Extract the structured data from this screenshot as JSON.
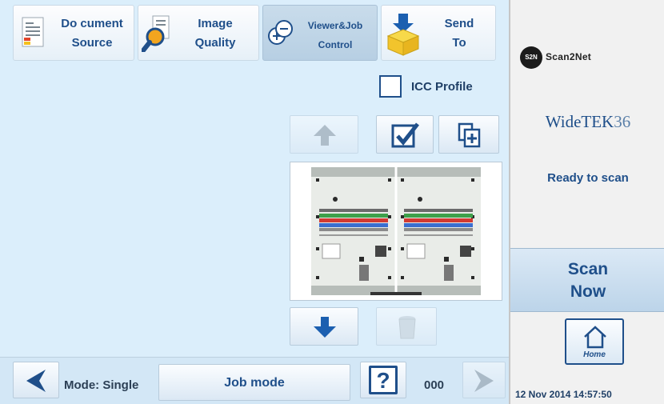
{
  "tabs": [
    {
      "line1": "Do cument",
      "line2": "Source",
      "icon": "document-icon"
    },
    {
      "line1": "Image",
      "line2": "Quality",
      "icon": "magnifier-icon"
    },
    {
      "line1": "Viewer&Job",
      "line2": "Control",
      "icon": "zoom-icon"
    },
    {
      "line1": "Send",
      "line2": "To",
      "icon": "box-arrow-icon"
    }
  ],
  "icc_profile_label": "ICC Profile",
  "bottom_bar": {
    "mode_label": "Mode: Single",
    "job_mode_label": "Job mode",
    "help_label": "?",
    "page_counter": "000"
  },
  "sidebar": {
    "logo_text": "Scan2Net",
    "logo_badge": "S2N",
    "model": "WideTEK",
    "model_number": "36",
    "status": "Ready to scan",
    "scan_line1": "Scan",
    "scan_line2": "Now",
    "home_label": "Home",
    "datetime": "12 Nov 2014 14:57:50"
  },
  "colors": {
    "accent": "#1f4f8a",
    "arrow_blue": "#1b5fb0",
    "panel_bg": "#dbeefb"
  }
}
